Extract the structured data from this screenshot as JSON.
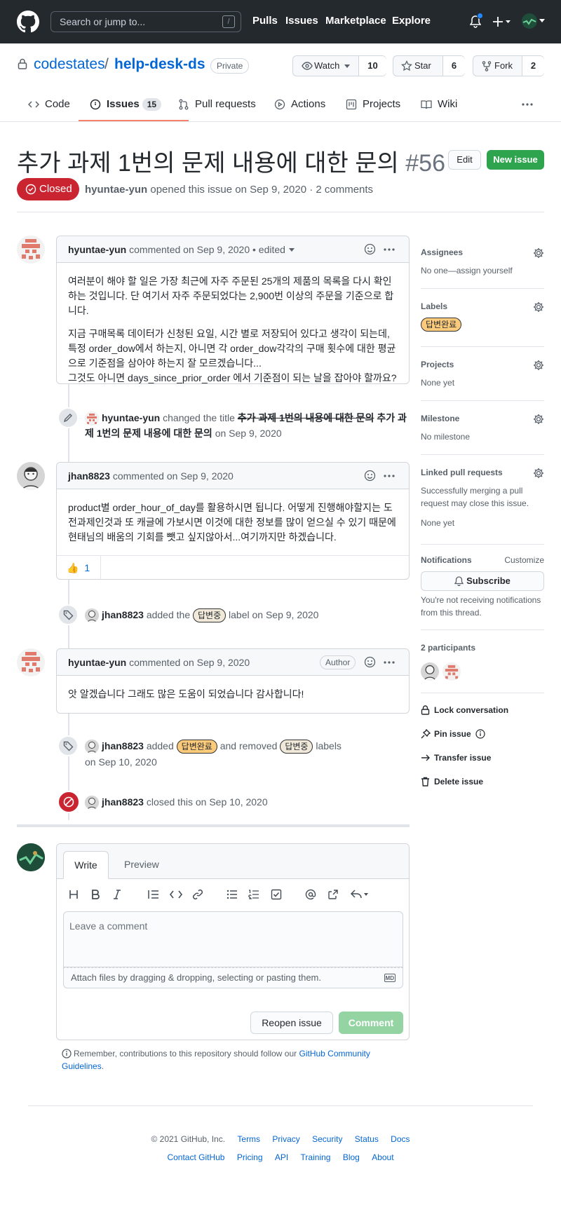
{
  "header": {
    "search_placeholder": "Search or jump to...",
    "search_key": "/",
    "nav": [
      "Pulls",
      "Issues",
      "Marketplace",
      "Explore"
    ]
  },
  "repo": {
    "owner": "codestates",
    "separator": "/",
    "name": "help-desk-ds",
    "visibility": "Private",
    "watch_label": "Watch",
    "watch_count": "10",
    "star_label": "Star",
    "star_count": "6",
    "fork_label": "Fork",
    "fork_count": "2"
  },
  "tabs": [
    {
      "label": "Code"
    },
    {
      "label": "Issues",
      "count": "15"
    },
    {
      "label": "Pull requests"
    },
    {
      "label": "Actions"
    },
    {
      "label": "Projects"
    },
    {
      "label": "Wiki"
    }
  ],
  "issue": {
    "title": "추가 과제 1번의 문제 내용에 대한 문의",
    "number": "#56",
    "edit_label": "Edit",
    "new_issue_label": "New issue",
    "state": "Closed",
    "author": "hyuntae-yun",
    "meta_text": "opened this issue on Sep 9, 2020 · 2 comments"
  },
  "timeline": {
    "comment1": {
      "author": "hyuntae-yun",
      "meta": "commented on Sep 9, 2020 • edited",
      "p1": "여러분이 해야 할 일은 가장 최근에 자주 주문된 25개의 제품의 목록을 다시 확인하는 것입니다. 단 여기서 자주 주문되었다는 2,900번 이상의 주문을 기준으로 합니다.",
      "p2": "지금 구매목록 데이터가 신청된 요일, 시간 별로 저장되어 있다고 생각이 되는데, 특정 order_dow에서 하는지, 아니면 각 order_dow각각의 구매 횟수에 대한 평균으로 기준점을 삼아야 하는지 잘 모르겠습니다...",
      "p3": "그것도 아니면 days_since_prior_order 에서 기준점이 되는 날을 잡아야 할까요?"
    },
    "rename": {
      "actor": "hyuntae-yun",
      "action": "changed the title",
      "old_title": "추가 과제 1번의 내용에 대한 문의",
      "new_title": "추가 과제 1번의 문제 내용에 대한 문의",
      "date": "on Sep 9, 2020"
    },
    "comment2": {
      "author": "jhan8823",
      "meta": "commented on Sep 9, 2020",
      "body": "product별 order_hour_of_day를 활용하시면 됩니다. 어떻게 진행해야할지는 도전과제인것과 또 캐글에 가보시면 이것에 대한 정보를 많이 얻으실 수 있기 때문에 현태님의 배움의 기회를 뺏고 싶지않아서...여기까지만 하겠습니다.",
      "reaction_emoji": "👍",
      "reaction_count": "1"
    },
    "label_event1": {
      "actor": "jhan8823",
      "text_a": "added the",
      "label": "답변중",
      "text_b": "label on Sep 9, 2020"
    },
    "comment3": {
      "author": "hyuntae-yun",
      "meta": "commented on Sep 9, 2020",
      "badge": "Author",
      "body": "앗 알겠습니다 그래도 많은 도움이 되었습니다 감사합니다!"
    },
    "label_event2": {
      "actor": "jhan8823",
      "text_a": "added",
      "added_label": "답변완료",
      "text_b": "and removed",
      "removed_label": "답변중",
      "text_c": "labels",
      "date": "on Sep 10, 2020"
    },
    "close_event": {
      "actor": "jhan8823",
      "text": "closed this on Sep 10, 2020"
    }
  },
  "sidebar": {
    "assignees_title": "Assignees",
    "assignees_value": "No one—assign yourself",
    "labels_title": "Labels",
    "label": "답변완료",
    "projects_title": "Projects",
    "projects_value": "None yet",
    "milestone_title": "Milestone",
    "milestone_value": "No milestone",
    "linked_title": "Linked pull requests",
    "linked_desc": "Successfully merging a pull request may close this issue.",
    "linked_value": "None yet",
    "notifications_title": "Notifications",
    "customize": "Customize",
    "subscribe": "Subscribe",
    "notif_desc": "You're not receiving notifications from this thread.",
    "participants": "2 participants",
    "actions": [
      "Lock conversation",
      "Pin issue",
      "Transfer issue",
      "Delete issue"
    ]
  },
  "comment_form": {
    "write_tab": "Write",
    "preview_tab": "Preview",
    "placeholder": "Leave a comment",
    "attach_text": "Attach files by dragging & dropping, selecting or pasting them.",
    "md_badge": "MD",
    "reopen_label": "Reopen issue",
    "comment_label": "Comment",
    "remember_text": "Remember, contributions to this repository should follow our",
    "guidelines_link": "GitHub Community Guidelines",
    "guidelines_end": "."
  },
  "footer": {
    "copyright": "© 2021 GitHub, Inc.",
    "row1": [
      "Terms",
      "Privacy",
      "Security",
      "Status",
      "Docs"
    ],
    "row2": [
      "Contact GitHub",
      "Pricing",
      "API",
      "Training",
      "Blog",
      "About"
    ]
  },
  "colors": {
    "closed": "#cb2431",
    "link": "#0366d6",
    "primary_button": "#2ea44f",
    "label_done": "#fbca7a",
    "header_bg": "#24292e"
  }
}
